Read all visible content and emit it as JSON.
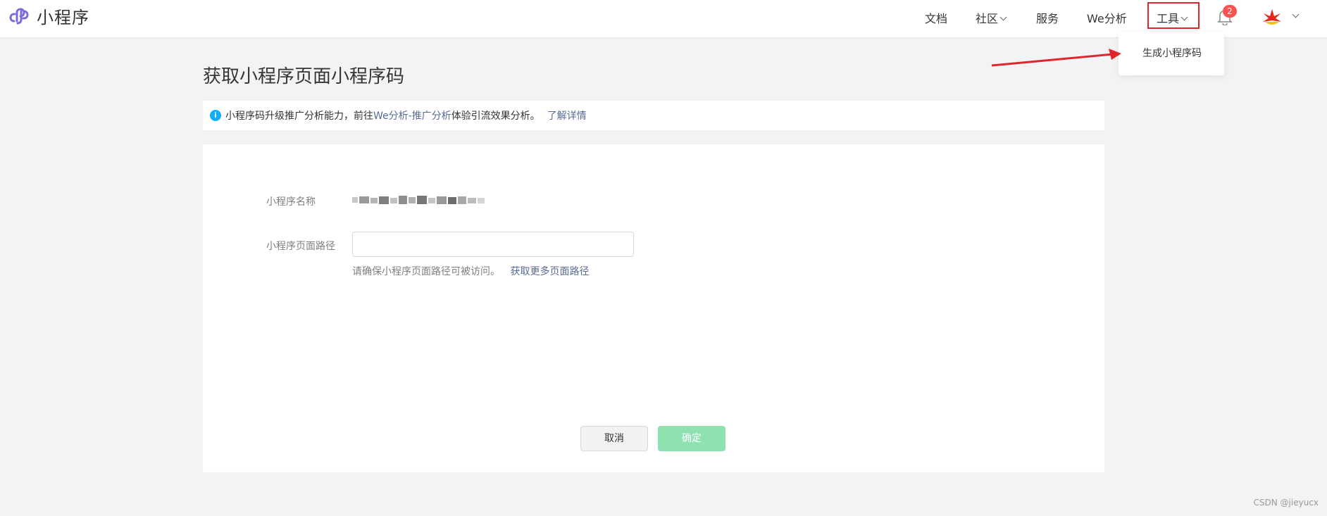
{
  "header": {
    "app_name": "小程序",
    "nav": {
      "docs": "文档",
      "community": "社区",
      "services": "服务",
      "we_analytics": "We分析",
      "tools": "工具"
    },
    "notification_count": "2"
  },
  "dropdown": {
    "items": [
      "生成小程序码"
    ]
  },
  "page": {
    "title": "获取小程序页面小程序码",
    "notice": {
      "text_before": "小程序码升级推广分析能力，前往",
      "link": "We分析-推广分析",
      "text_after": "体验引流效果分析。",
      "more_link": "了解详情"
    },
    "form": {
      "name_label": "小程序名称",
      "path_label": "小程序页面路径",
      "path_value": "",
      "hint": "请确保小程序页面路径可被访问。",
      "hint_link": "获取更多页面路径"
    },
    "buttons": {
      "cancel": "取消",
      "confirm": "确定"
    }
  },
  "watermark": "CSDN @jieyucx",
  "colors": {
    "accent_link": "#576b95",
    "confirm_disabled": "#8ee1b0",
    "badge": "#fa5151",
    "highlight_box": "#e0262d"
  }
}
